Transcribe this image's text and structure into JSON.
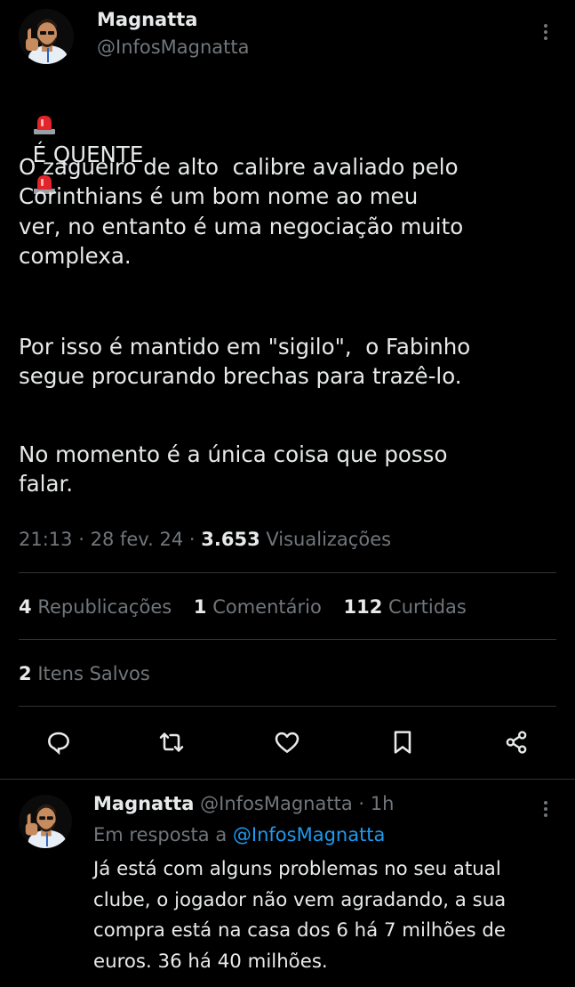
{
  "tweet": {
    "author_name": "Magnatta",
    "author_handle": "@InfosMagnatta",
    "headline": "É QUENTE",
    "paragraph1": "O zagueiro de alto  calibre avaliado pelo\nCorinthians é um bom nome ao meu\nver, no entanto é uma negociação muito\ncomplexa.",
    "paragraph2": "Por isso é mantido em \"sigilo\",  o Fabinho\nsegue procurando brechas para trazê-lo.",
    "paragraph3": "No momento é a única coisa que posso\nfalar.",
    "time": "21:13",
    "date": "28 fev. 24",
    "views_count": "3.653",
    "views_label": "Visualizações",
    "separator": "·"
  },
  "stats": {
    "reposts_count": "4",
    "reposts_label": "Republicações",
    "comments_count": "1",
    "comments_label": "Comentário",
    "likes_count": "112",
    "likes_label": "Curtidas",
    "saves_count": "2",
    "saves_label": "Itens Salvos"
  },
  "actions": [
    {
      "name": "reply-icon"
    },
    {
      "name": "retweet-icon"
    },
    {
      "name": "like-icon"
    },
    {
      "name": "bookmark-icon"
    },
    {
      "name": "share-icon"
    }
  ],
  "reply": {
    "author_name": "Magnatta",
    "author_handle": "@InfosMagnatta",
    "time_ago": "1h",
    "separator": "·",
    "in_reply_to_label": "Em resposta a",
    "in_reply_to_handle": "@InfosMagnatta",
    "text": "Já está com alguns problemas no seu atual clube, o jogador não vem agradando, a sua compra está na casa dos 6 há 7 milhões de euros. 36 há 40 milhões."
  },
  "colors": {
    "background": "#000000",
    "text": "#e7e9ea",
    "muted": "#71767b",
    "link": "#1d9bf0",
    "divider": "#2f3336"
  }
}
